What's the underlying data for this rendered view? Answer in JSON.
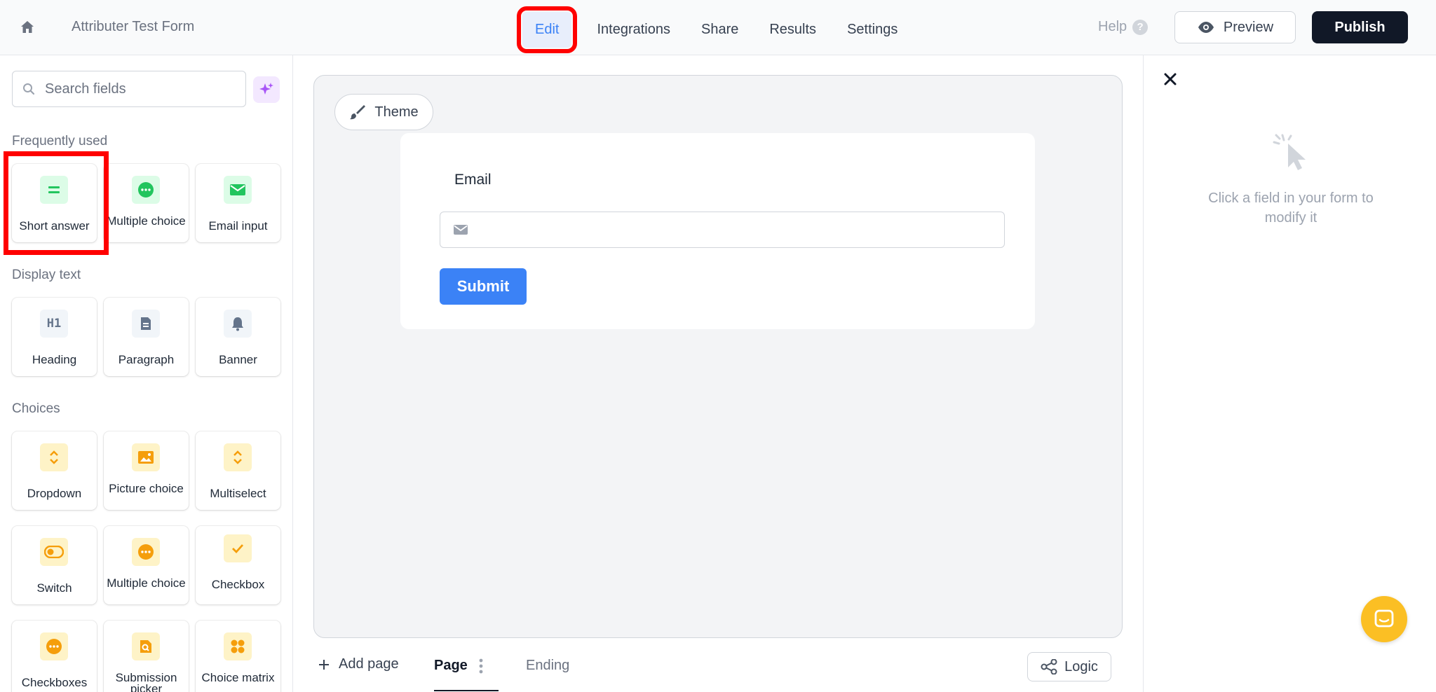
{
  "header": {
    "form_title": "Attributer Test Form",
    "tabs": [
      {
        "label": "Edit",
        "active": true
      },
      {
        "label": "Integrations"
      },
      {
        "label": "Share"
      },
      {
        "label": "Results"
      },
      {
        "label": "Settings"
      }
    ],
    "help_label": "Help",
    "help_icon_char": "?",
    "preview_label": "Preview",
    "publish_label": "Publish"
  },
  "sidebar": {
    "search_placeholder": "Search fields",
    "sections": [
      {
        "title": "Frequently used",
        "fields": [
          {
            "label": "Short answer",
            "icon": "short-answer-icon",
            "color": "#22c55e"
          },
          {
            "label": "Multiple choice",
            "icon": "multiple-choice-icon",
            "color": "#22c55e"
          },
          {
            "label": "Email input",
            "icon": "email-icon",
            "color": "#22c55e"
          }
        ]
      },
      {
        "title": "Display text",
        "fields": [
          {
            "label": "Heading",
            "icon": "heading-icon",
            "icon_text": "H1",
            "color": "#64748b"
          },
          {
            "label": "Paragraph",
            "icon": "paragraph-icon",
            "color": "#64748b"
          },
          {
            "label": "Banner",
            "icon": "bell-icon",
            "color": "#64748b"
          }
        ]
      },
      {
        "title": "Choices",
        "fields": [
          {
            "label": "Dropdown",
            "icon": "dropdown-icon",
            "color": "#f59e0b"
          },
          {
            "label": "Picture choice",
            "icon": "picture-icon",
            "color": "#f59e0b"
          },
          {
            "label": "Multiselect",
            "icon": "multiselect-icon",
            "color": "#f59e0b"
          },
          {
            "label": "Switch",
            "icon": "switch-icon",
            "color": "#f59e0b"
          },
          {
            "label": "Multiple choice",
            "icon": "multiple-choice-icon",
            "color": "#f59e0b"
          },
          {
            "label": "Checkbox",
            "icon": "checkbox-icon",
            "color": "#f59e0b"
          },
          {
            "label": "Checkboxes",
            "icon": "checkboxes-icon",
            "color": "#f59e0b"
          },
          {
            "label": "Submission picker",
            "icon": "submission-picker-icon",
            "color": "#f59e0b"
          },
          {
            "label": "Choice matrix",
            "icon": "choice-matrix-icon",
            "color": "#f59e0b"
          }
        ]
      }
    ]
  },
  "canvas": {
    "theme_label": "Theme",
    "email_label": "Email",
    "email_value": "",
    "submit_label": "Submit",
    "add_page_label": "Add page",
    "page_tab_label": "Page",
    "ending_tab_label": "Ending",
    "logic_label": "Logic"
  },
  "right_panel": {
    "empty_message": "Click a field in your form to modify it"
  },
  "colors": {
    "accent": "#3b82f6",
    "publish_bg": "#111827",
    "highlight": "#ff0000",
    "chat": "#fbbf24"
  }
}
